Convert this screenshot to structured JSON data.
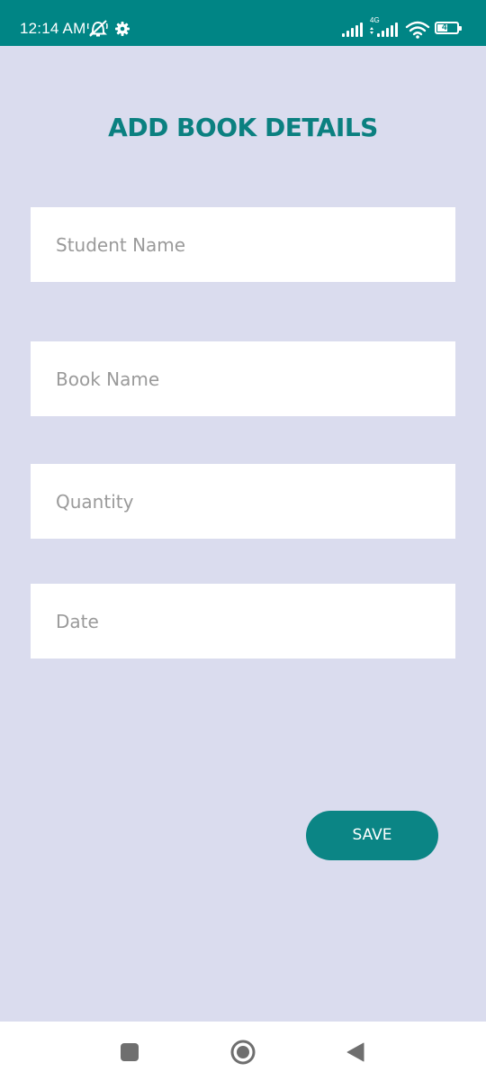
{
  "status_bar": {
    "time": "12:14 AM",
    "network_type": "4G",
    "battery_level": "49",
    "icons": [
      "mute-icon",
      "gear-icon",
      "signal-icon",
      "signal-icon",
      "wifi-icon",
      "battery-icon"
    ]
  },
  "page": {
    "title": "ADD BOOK DETAILS"
  },
  "form": {
    "student_name": {
      "placeholder": "Student Name",
      "value": ""
    },
    "book_name": {
      "placeholder": "Book Name",
      "value": ""
    },
    "quantity": {
      "placeholder": "Quantity",
      "value": ""
    },
    "date": {
      "placeholder": "Date",
      "value": ""
    }
  },
  "actions": {
    "save_label": "SAVE"
  },
  "nav_bar": {
    "buttons": [
      "recent-apps-icon",
      "home-icon",
      "back-icon"
    ]
  },
  "colors": {
    "primary": "#008585",
    "background": "#dadcee",
    "field_bg": "#ffffff",
    "placeholder": "#9a9a9a"
  }
}
